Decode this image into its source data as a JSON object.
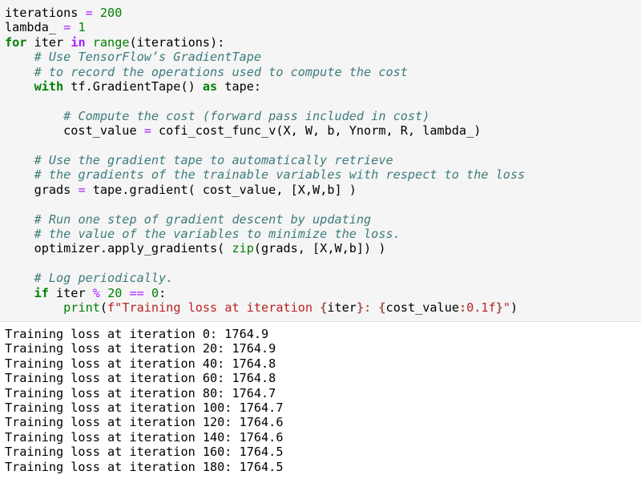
{
  "code_lines": [
    [
      [
        "tx",
        "iterations "
      ],
      [
        "op",
        "="
      ],
      [
        "tx",
        " "
      ],
      [
        "num",
        "200"
      ]
    ],
    [
      [
        "tx",
        "lambda_ "
      ],
      [
        "op",
        "="
      ],
      [
        "tx",
        " "
      ],
      [
        "num",
        "1"
      ]
    ],
    [
      [
        "kw",
        "for"
      ],
      [
        "tx",
        " iter "
      ],
      [
        "opw",
        "in"
      ],
      [
        "tx",
        " "
      ],
      [
        "bi",
        "range"
      ],
      [
        "tx",
        "(iterations):"
      ]
    ],
    [
      [
        "tx",
        "    "
      ],
      [
        "cm",
        "# Use TensorFlow’s GradientTape"
      ]
    ],
    [
      [
        "tx",
        "    "
      ],
      [
        "cm",
        "# to record the operations used to compute the cost "
      ]
    ],
    [
      [
        "tx",
        "    "
      ],
      [
        "kw",
        "with"
      ],
      [
        "tx",
        " tf.GradientTape() "
      ],
      [
        "kw",
        "as"
      ],
      [
        "tx",
        " tape:"
      ]
    ],
    [],
    [
      [
        "tx",
        "        "
      ],
      [
        "cm",
        "# Compute the cost (forward pass included in cost)"
      ]
    ],
    [
      [
        "tx",
        "        cost_value "
      ],
      [
        "op",
        "="
      ],
      [
        "tx",
        " cofi_cost_func_v(X, W, b, Ynorm, R, lambda_)"
      ]
    ],
    [],
    [
      [
        "tx",
        "    "
      ],
      [
        "cm",
        "# Use the gradient tape to automatically retrieve"
      ]
    ],
    [
      [
        "tx",
        "    "
      ],
      [
        "cm",
        "# the gradients of the trainable variables with respect to the loss"
      ]
    ],
    [
      [
        "tx",
        "    grads "
      ],
      [
        "op",
        "="
      ],
      [
        "tx",
        " tape.gradient( cost_value, [X,W,b] )"
      ]
    ],
    [],
    [
      [
        "tx",
        "    "
      ],
      [
        "cm",
        "# Run one step of gradient descent by updating"
      ]
    ],
    [
      [
        "tx",
        "    "
      ],
      [
        "cm",
        "# the value of the variables to minimize the loss."
      ]
    ],
    [
      [
        "tx",
        "    optimizer.apply_gradients( "
      ],
      [
        "bi",
        "zip"
      ],
      [
        "tx",
        "(grads, [X,W,b]) )"
      ]
    ],
    [],
    [
      [
        "tx",
        "    "
      ],
      [
        "cm",
        "# Log periodically."
      ]
    ],
    [
      [
        "tx",
        "    "
      ],
      [
        "kw",
        "if"
      ],
      [
        "tx",
        " iter "
      ],
      [
        "op",
        "%"
      ],
      [
        "tx",
        " "
      ],
      [
        "num",
        "20"
      ],
      [
        "tx",
        " "
      ],
      [
        "op",
        "=="
      ],
      [
        "tx",
        " "
      ],
      [
        "num",
        "0"
      ],
      [
        "tx",
        ":"
      ]
    ],
    [
      [
        "tx",
        "        "
      ],
      [
        "bi",
        "print"
      ],
      [
        "tx",
        "("
      ],
      [
        "str",
        "f\"Training loss at iteration "
      ],
      [
        "interp",
        "{"
      ],
      [
        "tx",
        "iter"
      ],
      [
        "interp",
        "}"
      ],
      [
        "str",
        ": "
      ],
      [
        "interp",
        "{"
      ],
      [
        "tx",
        "cost_value"
      ],
      [
        "interp",
        ":"
      ],
      [
        "str",
        "0.1f"
      ],
      [
        "interp",
        "}"
      ],
      [
        "str",
        "\""
      ],
      [
        "tx",
        ")"
      ]
    ]
  ],
  "output_lines": [
    "Training loss at iteration 0: 1764.9",
    "Training loss at iteration 20: 1764.9",
    "Training loss at iteration 40: 1764.8",
    "Training loss at iteration 60: 1764.8",
    "Training loss at iteration 80: 1764.7",
    "Training loss at iteration 100: 1764.7",
    "Training loss at iteration 120: 1764.6",
    "Training loss at iteration 140: 1764.6",
    "Training loss at iteration 160: 1764.5",
    "Training loss at iteration 180: 1764.5"
  ]
}
